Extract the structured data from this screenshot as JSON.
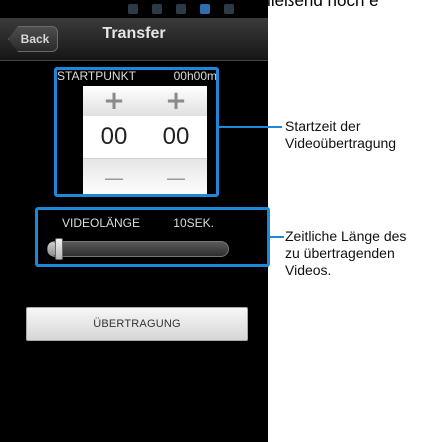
{
  "page_caption": "Sie „ÜBERTRAGUNG“ anschließend noch e",
  "header": {
    "back_label": "Back",
    "title": "Transfer"
  },
  "start": {
    "label": "STARTPUNKT",
    "time": "00h00m",
    "spinners": [
      {
        "plus": "+",
        "value": "00",
        "minus": "—"
      },
      {
        "plus": "+",
        "value": "00",
        "minus": "—"
      }
    ]
  },
  "video": {
    "label": "VIDEOLÄNGE",
    "duration": "10SEK.",
    "slider_level": 0.05
  },
  "transfer_button": "ÜBERTRAGUNG",
  "annotations": {
    "start_time": [
      "Startzeit der",
      "Videoübertragung"
    ],
    "video_length": [
      "Zeitliche Länge des",
      "zu übertragenden",
      "Videos."
    ]
  },
  "colors": {
    "callout": "#1e88d8",
    "phone_bg": "#000000",
    "header_bg": "#2a2a2a"
  }
}
